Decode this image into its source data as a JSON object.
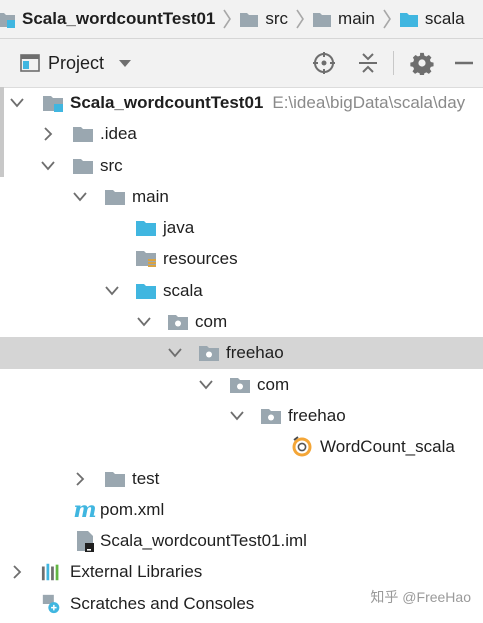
{
  "breadcrumb": {
    "items": [
      {
        "label": "Scala_wordcountTest01",
        "icon": "module-folder-icon"
      },
      {
        "label": "src",
        "icon": "folder-icon"
      },
      {
        "label": "main",
        "icon": "folder-icon"
      },
      {
        "label": "scala",
        "icon": "source-folder-icon"
      }
    ]
  },
  "toolbar": {
    "title": "Project",
    "icons": [
      "locate-icon",
      "collapse-all-icon",
      "gear-icon",
      "hide-icon"
    ]
  },
  "tree": {
    "project_name": "Scala_wordcountTest01",
    "project_path": "E:\\idea\\bigData\\scala\\day",
    "idea": ".idea",
    "src": "src",
    "main": "main",
    "java": "java",
    "resources": "resources",
    "scala": "scala",
    "com1": "com",
    "freehao1": "freehao",
    "com2": "com",
    "freehao2": "freehao",
    "wordcount": "WordCount_scala",
    "test": "test",
    "pom": "pom.xml",
    "iml": "Scala_wordcountTest01.iml",
    "external": "External Libraries",
    "scratches": "Scratches and Consoles"
  },
  "watermark": "知乎 @FreeHao",
  "colors": {
    "folder_gray": "#9aa7b0",
    "source_blue": "#40b6e0",
    "selection": "#d5d5d5",
    "scala_orange": "#f4a637"
  }
}
